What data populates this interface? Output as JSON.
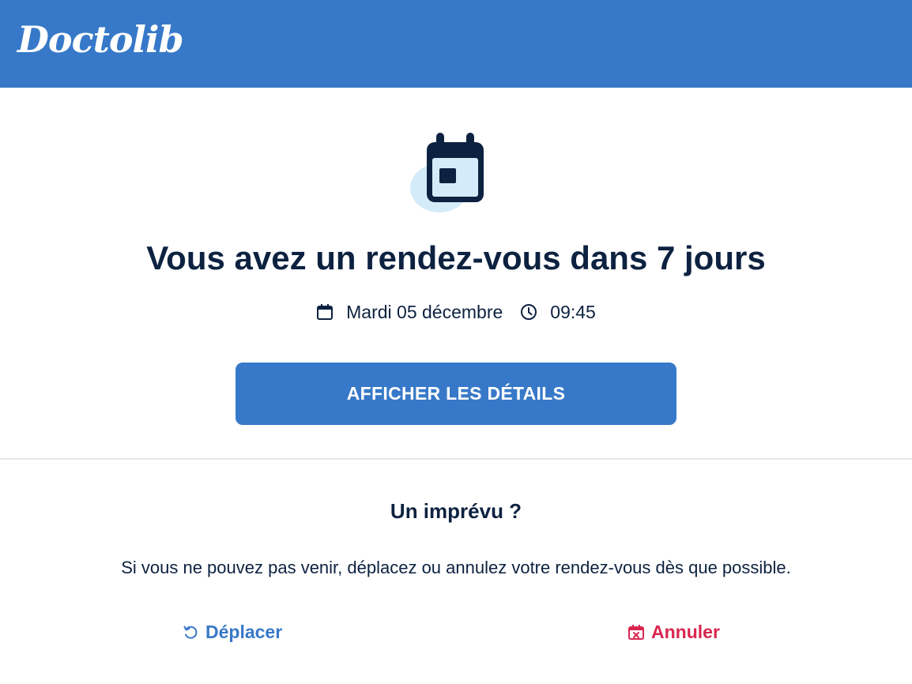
{
  "brand": {
    "logo_text": "Doctolib",
    "primary_color": "#3779c8",
    "danger_color": "#d8264f",
    "text_color": "#0d2240"
  },
  "hero": {
    "icon": "calendar-icon",
    "title": "Vous avez un rendez-vous dans 7 jours"
  },
  "appointment": {
    "date_icon": "calendar-icon",
    "date": "Mardi 05 décembre",
    "time_icon": "clock-icon",
    "time": "09:45"
  },
  "details_button": {
    "label": "AFFICHER LES DÉTAILS"
  },
  "unexpected": {
    "title": "Un imprévu ?",
    "text": "Si vous ne pouvez pas venir, déplacez ou annulez votre rendez-vous dès que possible."
  },
  "actions": {
    "move": {
      "icon": "undo-arrow-icon",
      "label": "Déplacer"
    },
    "cancel": {
      "icon": "calendar-cancel-icon",
      "label": "Annuler"
    }
  }
}
